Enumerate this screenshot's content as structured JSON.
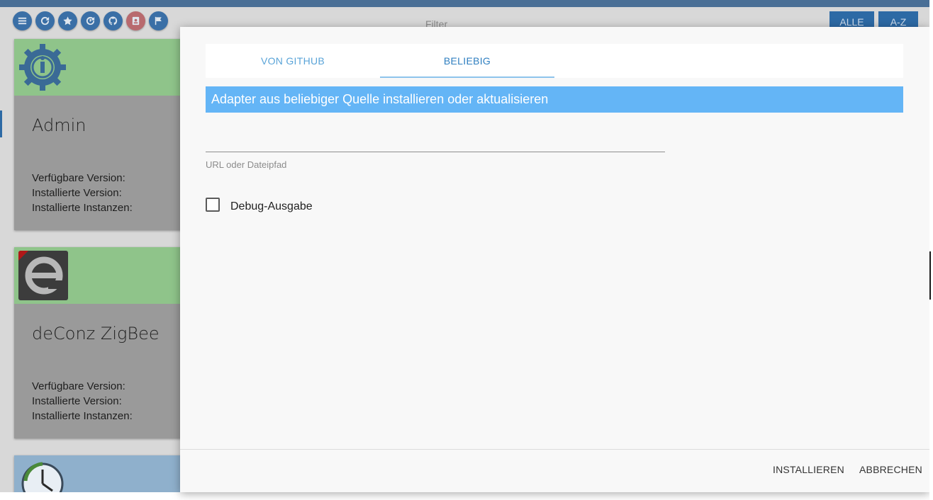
{
  "background": {
    "filter_placeholder": "Filter",
    "toolbar_icons": [
      "list-icon",
      "refresh-icon",
      "star-icon",
      "update-icon",
      "github-icon",
      "contact-icon",
      "flag-icon"
    ],
    "sort_buttons": [
      "ALLE",
      "A-Z"
    ],
    "cards": [
      {
        "title": "Admin",
        "available_version_label": "Verfügbare Version:",
        "installed_version_label": "Installierte Version:",
        "installed_instances_label": "Installierte Instanzen:"
      },
      {
        "title": "deConz ZigBee",
        "available_version_label": "Verfügbare Version:",
        "installed_version_label": "Installierte Version:",
        "installed_instances_label": "Installierte Instanzen:"
      }
    ]
  },
  "dialog": {
    "tabs": [
      {
        "label": "VON GITHUB",
        "active": false
      },
      {
        "label": "BELIEBIG",
        "active": true
      }
    ],
    "section_title": "Adapter aus beliebiger Quelle installieren oder aktualisieren",
    "url_input": {
      "value": "",
      "label": "URL oder Dateipfad"
    },
    "debug_checkbox": {
      "label": "Debug-Ausgabe",
      "checked": false
    },
    "buttons": {
      "install": "INSTALLIEREN",
      "cancel": "ABBRECHEN"
    }
  },
  "colors": {
    "accent": "#64b5f6",
    "tab_text": "#5aa4d8",
    "header_green": "#8fc48a",
    "toolbar_blue": "#3a6fa6"
  }
}
